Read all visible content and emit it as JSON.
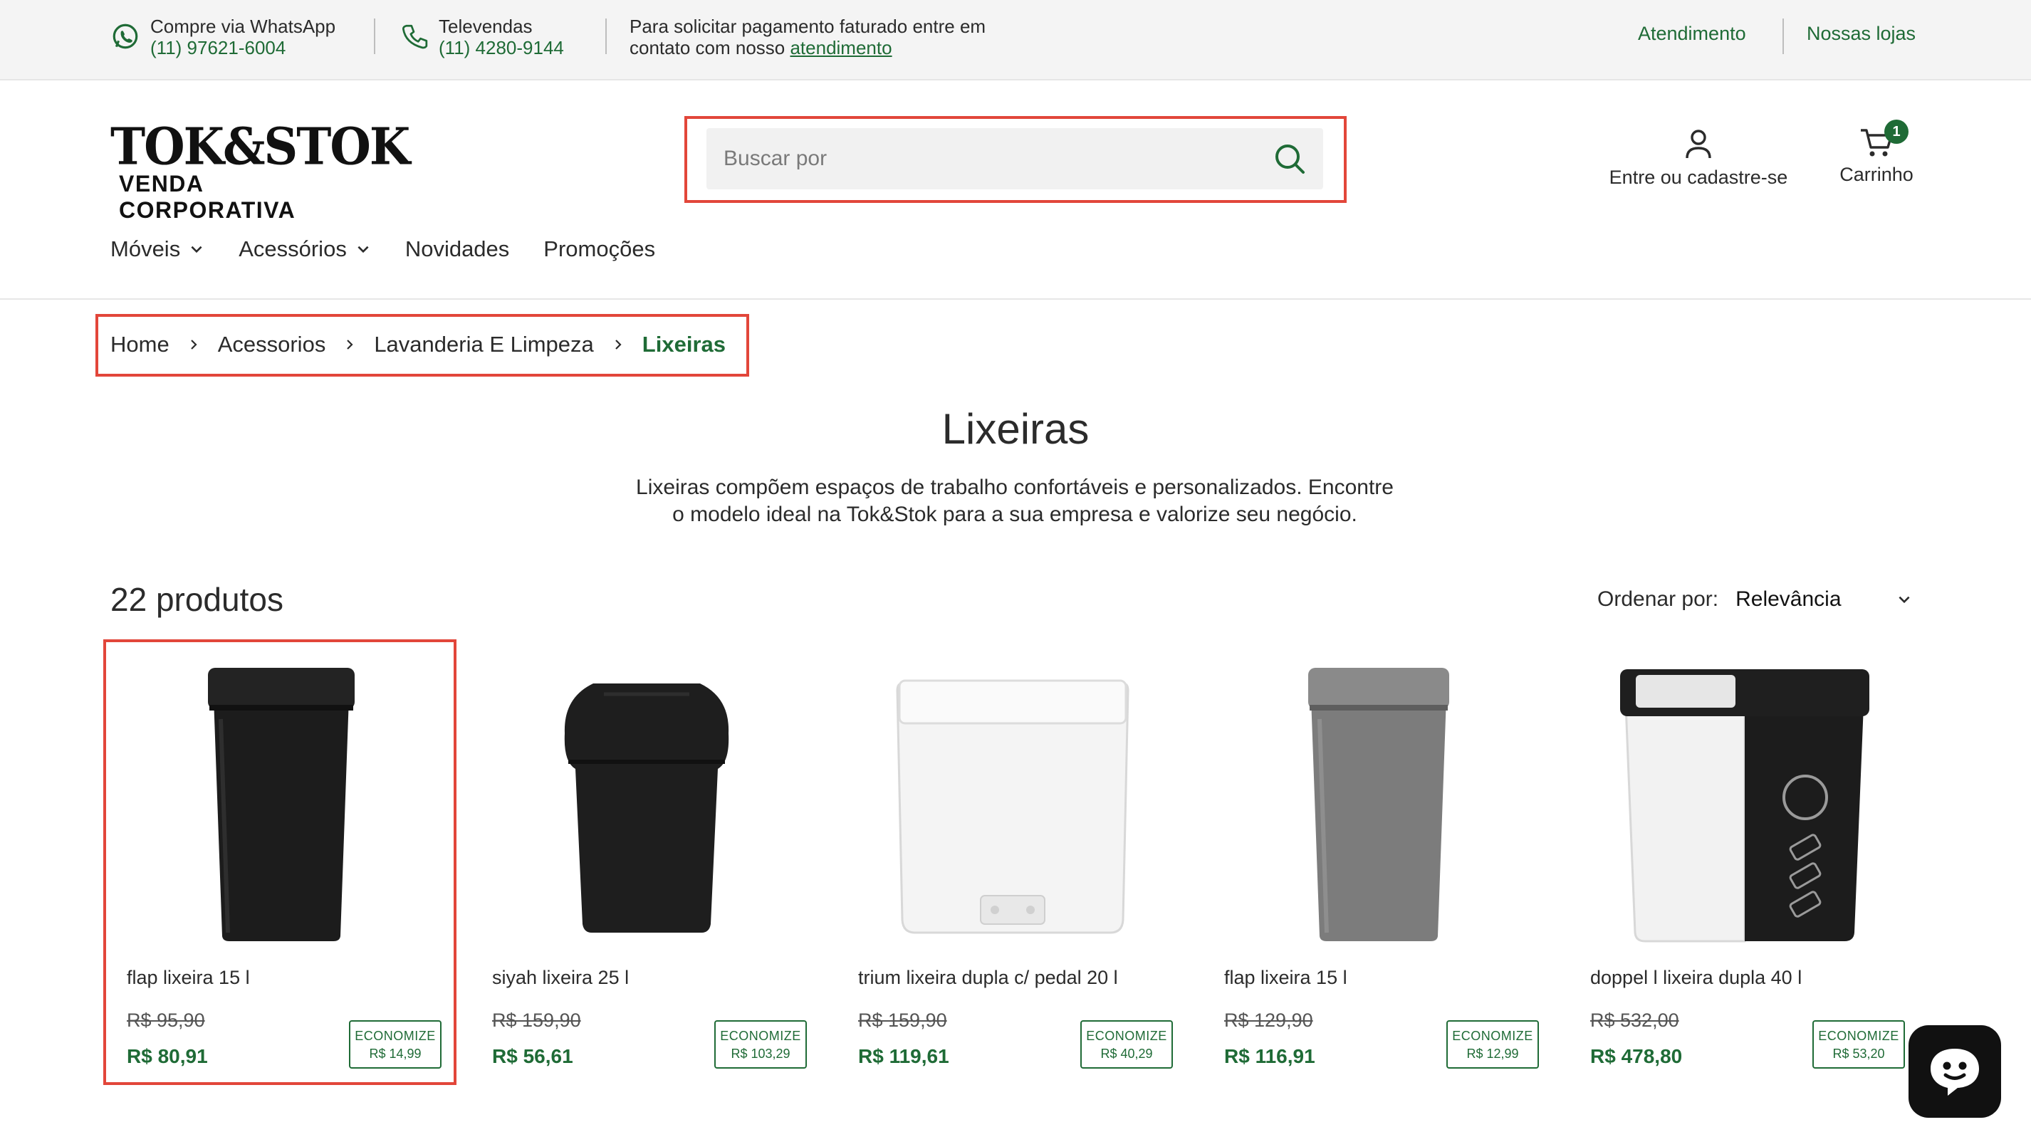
{
  "topbar": {
    "whatsapp": {
      "label": "Compre via WhatsApp",
      "number": "(11) 97621-6004",
      "icon": "whatsapp-icon"
    },
    "televendas": {
      "label": "Televendas",
      "number": "(11) 4280-9144",
      "icon": "phone-icon"
    },
    "info": {
      "line1": "Para solicitar pagamento faturado entre em",
      "line2_prefix": "contato com nosso ",
      "line2_link": "atendimento"
    },
    "right_links": [
      "Atendimento",
      "Nossas lojas"
    ]
  },
  "header": {
    "logo_main": "TOK&STOK",
    "logo_sub": "VENDA CORPORATIVA",
    "search_placeholder": "Buscar por",
    "account_label": "Entre ou cadastre-se",
    "cart_label": "Carrinho",
    "cart_count": "1"
  },
  "nav": [
    {
      "label": "Móveis",
      "dropdown": true
    },
    {
      "label": "Acessórios",
      "dropdown": true
    },
    {
      "label": "Novidades",
      "dropdown": false
    },
    {
      "label": "Promoções",
      "dropdown": false
    }
  ],
  "breadcrumb": [
    "Home",
    "Acessorios",
    "Lavanderia E Limpeza",
    "Lixeiras"
  ],
  "page": {
    "title": "Lixeiras",
    "description_line1": "Lixeiras compõem espaços de trabalho confortáveis e personalizados. Encontre",
    "description_line2": "o modelo ideal na Tok&Stok para a sua empresa e valorize seu negócio."
  },
  "results": {
    "count": "22 produtos",
    "sort_label": "Ordenar por:",
    "sort_value": "Relevância"
  },
  "products": [
    {
      "name": "flap lixeira 15 l",
      "old_price": "R$ 95,90",
      "price": "R$ 80,91",
      "save_label": "ECONOMIZE",
      "save_value": "R$ 14,99"
    },
    {
      "name": "siyah lixeira 25 l",
      "old_price": "R$ 159,90",
      "price": "R$ 56,61",
      "save_label": "ECONOMIZE",
      "save_value": "R$ 103,29"
    },
    {
      "name": "trium lixeira dupla c/ pedal 20 l",
      "old_price": "R$ 159,90",
      "price": "R$ 119,61",
      "save_label": "ECONOMIZE",
      "save_value": "R$ 40,29"
    },
    {
      "name": "flap lixeira 15 l",
      "old_price": "R$ 129,90",
      "price": "R$ 116,91",
      "save_label": "ECONOMIZE",
      "save_value": "R$ 12,99"
    },
    {
      "name": "doppel l lixeira dupla 40 l",
      "old_price": "R$ 532,00",
      "price": "R$ 478,80",
      "save_label": "ECONOMIZE",
      "save_value": "R$ 53,20"
    }
  ],
  "colors": {
    "brand_green": "#1f6b36",
    "highlight_red": "#e2463a",
    "topbar_bg": "#f4f4f4"
  },
  "chat_icon": "chat-bubble-icon"
}
